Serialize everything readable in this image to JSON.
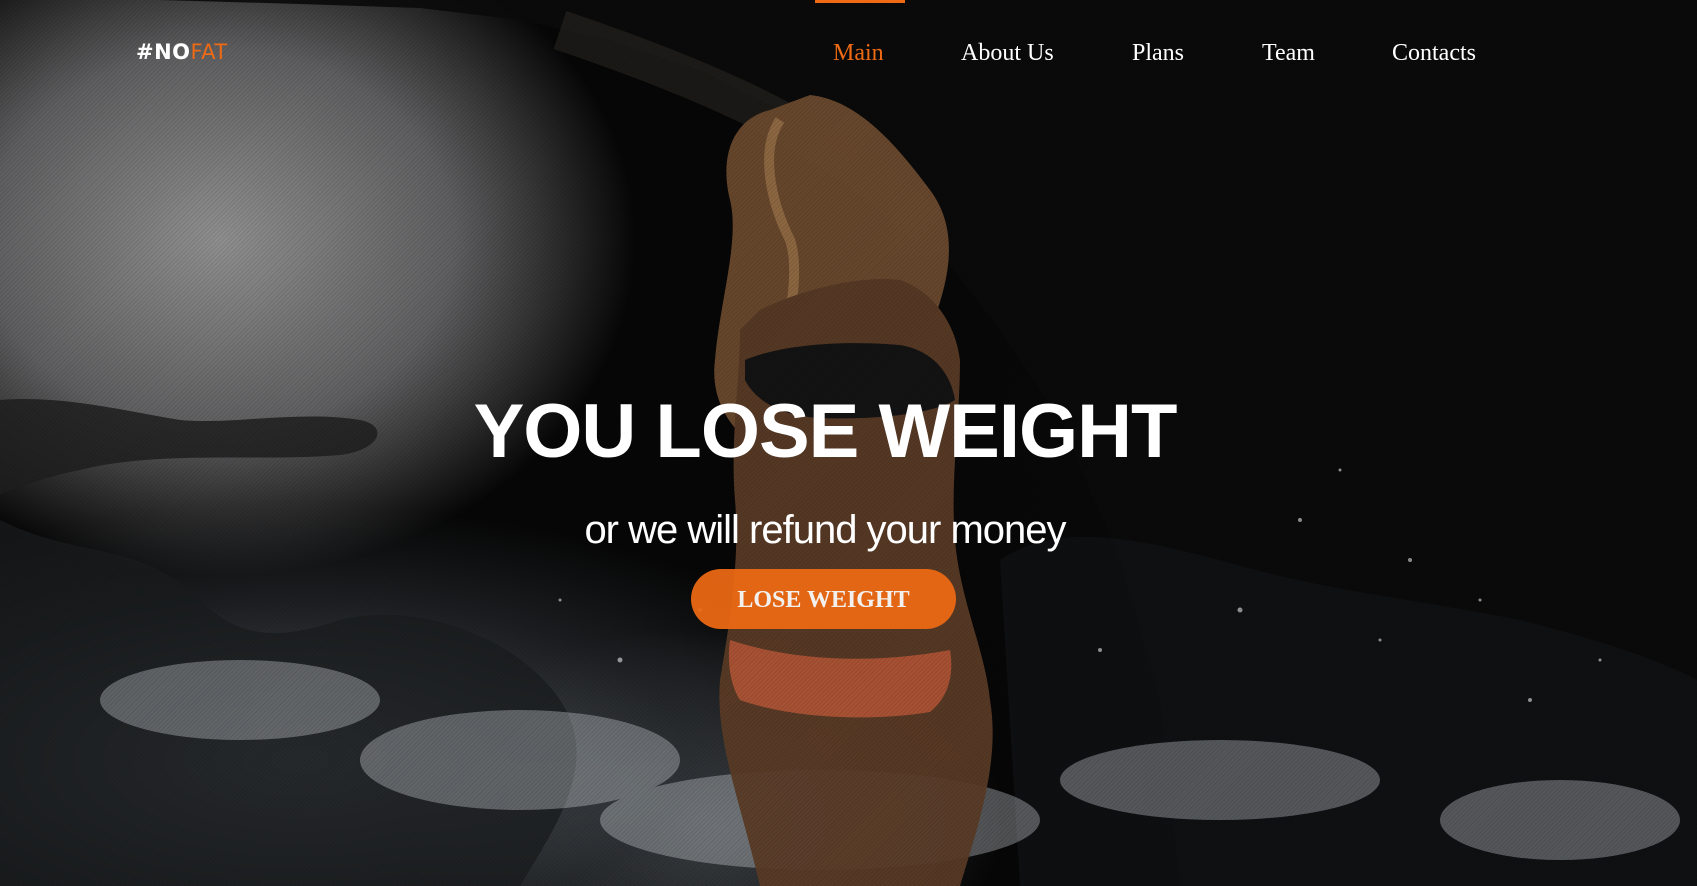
{
  "header": {
    "logo": {
      "primary": "#NO",
      "accent": "FAT"
    },
    "nav": [
      {
        "label": "Main",
        "active": true
      },
      {
        "label": "About Us",
        "active": false
      },
      {
        "label": "Plans",
        "active": false
      },
      {
        "label": "Team",
        "active": false
      },
      {
        "label": "Contacts",
        "active": false
      }
    ]
  },
  "hero": {
    "headline": "YOU LOSE WEIGHT",
    "subheadline": "or we will refund your money",
    "cta_label": "LOSE WEIGHT"
  },
  "colors": {
    "accent": "#ee6a14",
    "text": "#ffffff"
  }
}
